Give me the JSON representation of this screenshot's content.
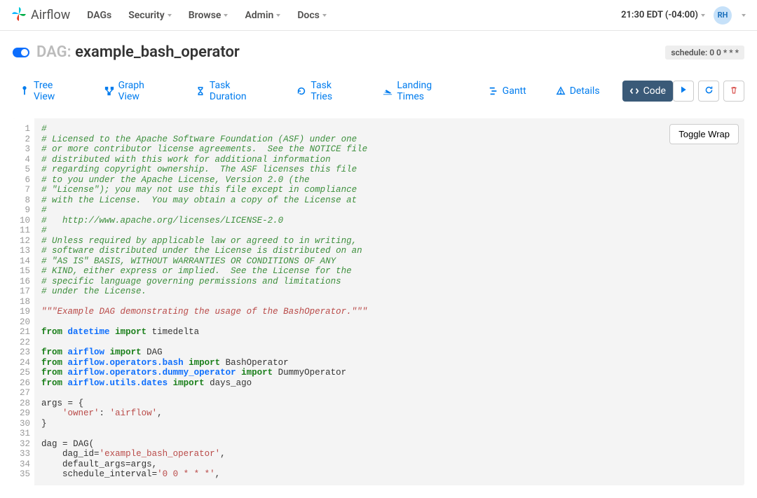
{
  "navbar": {
    "brand": "Airflow",
    "items": [
      {
        "label": "DAGs",
        "caret": false
      },
      {
        "label": "Security",
        "caret": true
      },
      {
        "label": "Browse",
        "caret": true
      },
      {
        "label": "Admin",
        "caret": true
      },
      {
        "label": "Docs",
        "caret": true
      }
    ],
    "time": "21:30 EDT (-04:00)",
    "avatar": "RH"
  },
  "header": {
    "dag_label": "DAG:",
    "dag_name": "example_bash_operator",
    "schedule_label": "schedule: 0 0 * * *"
  },
  "tabs": {
    "tree": "Tree View",
    "graph": "Graph View",
    "duration": "Task Duration",
    "tries": "Task Tries",
    "landing": "Landing Times",
    "gantt": "Gantt",
    "details": "Details",
    "code": "Code"
  },
  "toggle_wrap": "Toggle Wrap",
  "code": {
    "lines": [
      {
        "n": 1,
        "h": "<span class=\"tok-c\">#</span>"
      },
      {
        "n": 2,
        "h": "<span class=\"tok-c\"># Licensed to the Apache Software Foundation (ASF) under one</span>"
      },
      {
        "n": 3,
        "h": "<span class=\"tok-c\"># or more contributor license agreements.  See the NOTICE file</span>"
      },
      {
        "n": 4,
        "h": "<span class=\"tok-c\"># distributed with this work for additional information</span>"
      },
      {
        "n": 5,
        "h": "<span class=\"tok-c\"># regarding copyright ownership.  The ASF licenses this file</span>"
      },
      {
        "n": 6,
        "h": "<span class=\"tok-c\"># to you under the Apache License, Version 2.0 (the</span>"
      },
      {
        "n": 7,
        "h": "<span class=\"tok-c\"># \"License\"); you may not use this file except in compliance</span>"
      },
      {
        "n": 8,
        "h": "<span class=\"tok-c\"># with the License.  You may obtain a copy of the License at</span>"
      },
      {
        "n": 9,
        "h": "<span class=\"tok-c\">#</span>"
      },
      {
        "n": 10,
        "h": "<span class=\"tok-c\">#   http://www.apache.org/licenses/LICENSE-2.0</span>"
      },
      {
        "n": 11,
        "h": "<span class=\"tok-c\">#</span>"
      },
      {
        "n": 12,
        "h": "<span class=\"tok-c\"># Unless required by applicable law or agreed to in writing,</span>"
      },
      {
        "n": 13,
        "h": "<span class=\"tok-c\"># software distributed under the License is distributed on an</span>"
      },
      {
        "n": 14,
        "h": "<span class=\"tok-c\"># \"AS IS\" BASIS, WITHOUT WARRANTIES OR CONDITIONS OF ANY</span>"
      },
      {
        "n": 15,
        "h": "<span class=\"tok-c\"># KIND, either express or implied.  See the License for the</span>"
      },
      {
        "n": 16,
        "h": "<span class=\"tok-c\"># specific language governing permissions and limitations</span>"
      },
      {
        "n": 17,
        "h": "<span class=\"tok-c\"># under the License.</span>"
      },
      {
        "n": 18,
        "h": ""
      },
      {
        "n": 19,
        "h": "<span class=\"tok-ds\">\"\"\"Example DAG demonstrating the usage of the BashOperator.\"\"\"</span>"
      },
      {
        "n": 20,
        "h": ""
      },
      {
        "n": 21,
        "h": "<span class=\"tok-k\">from</span> <span class=\"tok-nn\">datetime</span> <span class=\"tok-k\">import</span> <span class=\"tok-n\">timedelta</span>"
      },
      {
        "n": 22,
        "h": ""
      },
      {
        "n": 23,
        "h": "<span class=\"tok-k\">from</span> <span class=\"tok-nn\">airflow</span> <span class=\"tok-k\">import</span> <span class=\"tok-n\">DAG</span>"
      },
      {
        "n": 24,
        "h": "<span class=\"tok-k\">from</span> <span class=\"tok-nn\">airflow.operators.bash</span> <span class=\"tok-k\">import</span> <span class=\"tok-n\">BashOperator</span>"
      },
      {
        "n": 25,
        "h": "<span class=\"tok-k\">from</span> <span class=\"tok-nn\">airflow.operators.dummy_operator</span> <span class=\"tok-k\">import</span> <span class=\"tok-n\">DummyOperator</span>"
      },
      {
        "n": 26,
        "h": "<span class=\"tok-k\">from</span> <span class=\"tok-nn\">airflow.utils.dates</span> <span class=\"tok-k\">import</span> <span class=\"tok-n\">days_ago</span>"
      },
      {
        "n": 27,
        "h": ""
      },
      {
        "n": 28,
        "h": "<span class=\"tok-n\">args</span> <span class=\"tok-p\">=</span> <span class=\"tok-p\">{</span>"
      },
      {
        "n": 29,
        "h": "    <span class=\"tok-s\">'owner'</span><span class=\"tok-p\">:</span> <span class=\"tok-s\">'airflow'</span><span class=\"tok-p\">,</span>"
      },
      {
        "n": 30,
        "h": "<span class=\"tok-p\">}</span>"
      },
      {
        "n": 31,
        "h": ""
      },
      {
        "n": 32,
        "h": "<span class=\"tok-n\">dag</span> <span class=\"tok-p\">=</span> <span class=\"tok-n\">DAG(</span>"
      },
      {
        "n": 33,
        "h": "    <span class=\"tok-n\">dag_id</span><span class=\"tok-p\">=</span><span class=\"tok-s\">'example_bash_operator'</span><span class=\"tok-p\">,</span>"
      },
      {
        "n": 34,
        "h": "    <span class=\"tok-n\">default_args</span><span class=\"tok-p\">=</span><span class=\"tok-n\">args</span><span class=\"tok-p\">,</span>"
      },
      {
        "n": 35,
        "h": "    <span class=\"tok-n\">schedule_interval</span><span class=\"tok-p\">=</span><span class=\"tok-s\">'0 0 * * *'</span><span class=\"tok-p\">,</span>"
      }
    ]
  }
}
